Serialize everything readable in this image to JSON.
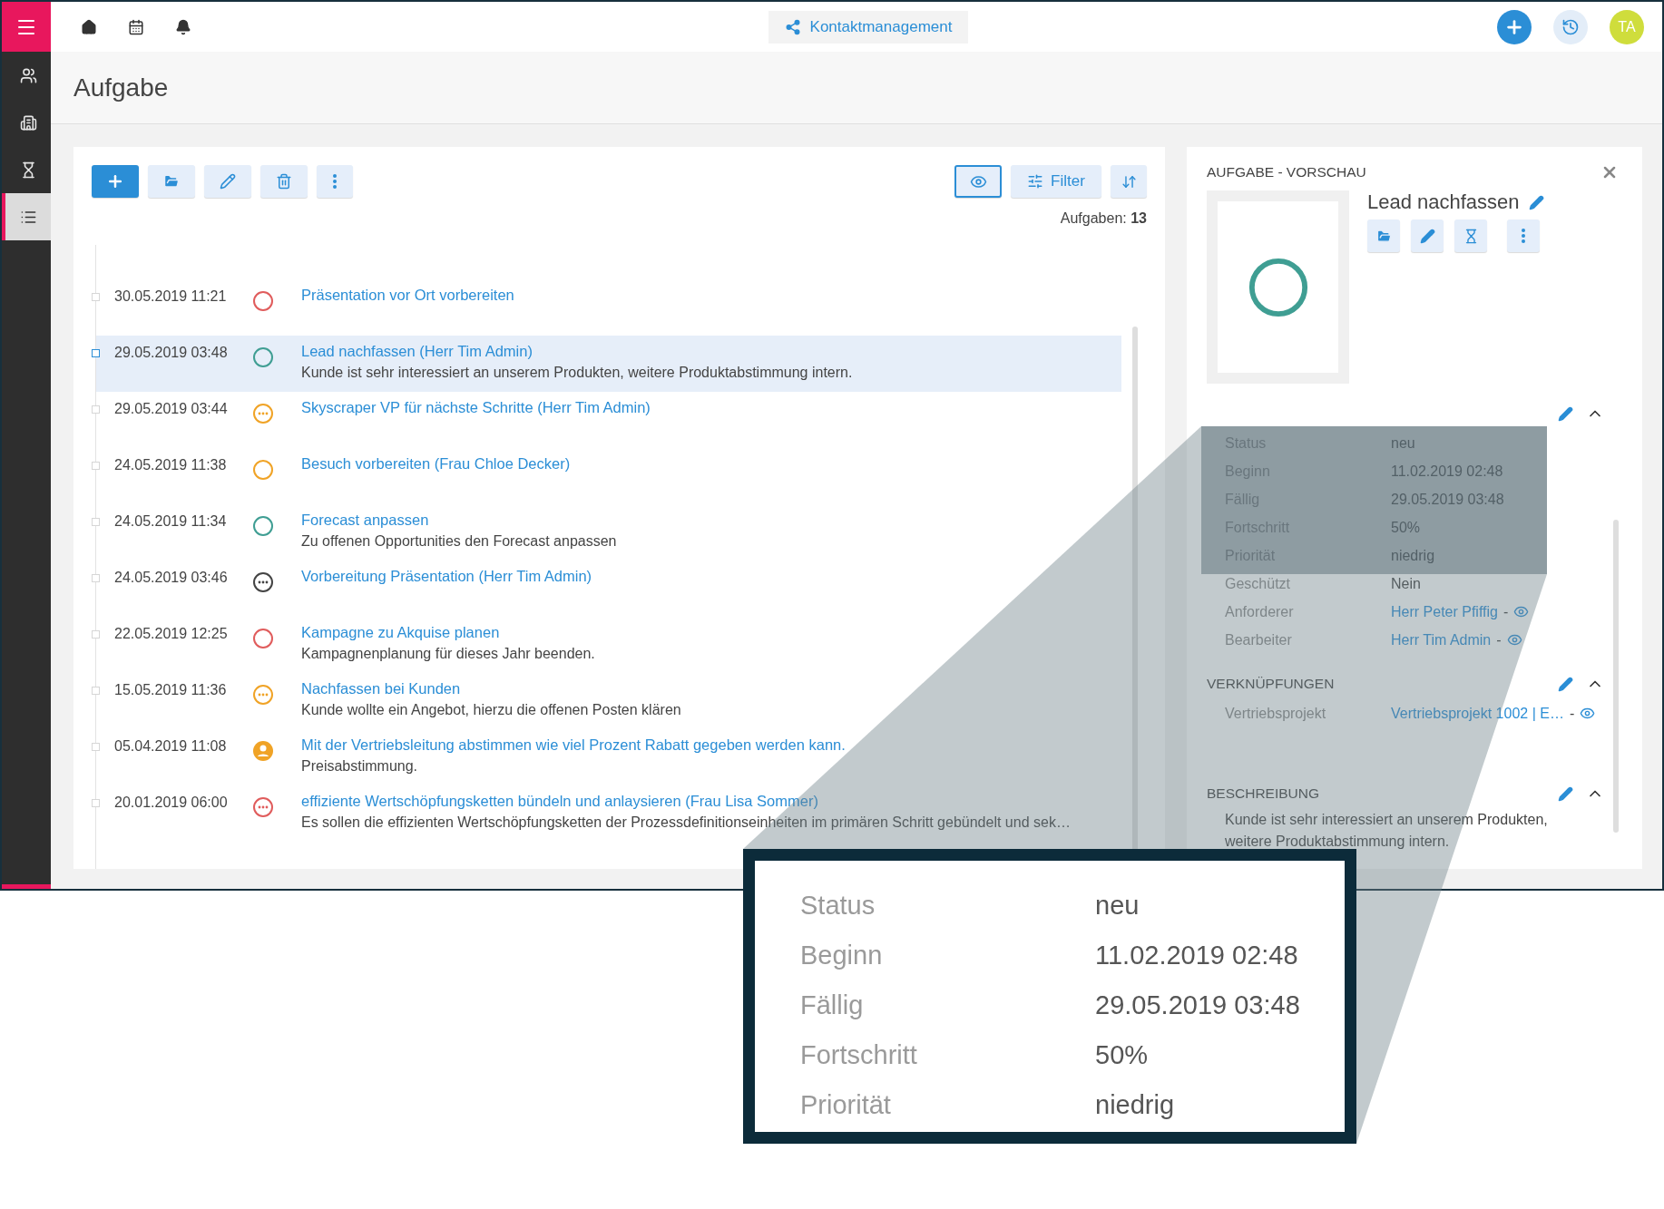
{
  "sidebar": {
    "items": [
      {
        "selected": false
      },
      {
        "selected": false
      },
      {
        "selected": false
      },
      {
        "selected": true
      }
    ]
  },
  "topbar": {
    "app_name": "Kontaktmanagement",
    "avatar": "TA"
  },
  "page": {
    "title": "Aufgabe"
  },
  "toolbar": {
    "view_toggle": {
      "selected": true
    },
    "filter_label": "Filter",
    "count": "Aufgaben: **13**"
  },
  "tasks": [
    {
      "date": "30.05.2019 11:21",
      "title": "Präsentation vor Ort vorbereiten",
      "kind": "open",
      "color": "#e05c5c",
      "selected": false
    },
    {
      "date": "29.05.2019 03:48",
      "title": "Lead nachfassen (Herr Tim Admin)",
      "description": "Kunde ist sehr interessiert an unserem Produkten, weitere Produktabstimmung intern.",
      "kind": "open",
      "color": "#3f9e93",
      "selected": true
    },
    {
      "date": "29.05.2019 03:44",
      "title": "Skyscraper VP für nächste Schritte (Herr Tim Admin)",
      "kind": "waiting",
      "color": "#f0a326",
      "selected": false
    },
    {
      "date": "24.05.2019 11:38",
      "title": "Besuch vorbereiten (Frau Chloe Decker)",
      "kind": "open",
      "color": "#f0a326",
      "selected": false
    },
    {
      "date": "24.05.2019 11:34",
      "title": "Forecast anpassen",
      "description": "Zu offenen Opportunities den Forecast anpassen",
      "kind": "open",
      "color": "#3f9e93",
      "selected": false
    },
    {
      "date": "24.05.2019 03:46",
      "title": "Vorbereitung Präsentation (Herr Tim Admin)",
      "kind": "waiting",
      "color": "#444444",
      "selected": false
    },
    {
      "date": "22.05.2019 12:25",
      "title": "Kampagne zu Akquise planen",
      "description": "Kampagnenplanung für dieses Jahr beenden.",
      "kind": "open",
      "color": "#e05c5c",
      "selected": false
    },
    {
      "date": "15.05.2019 11:36",
      "title": "Nachfassen bei Kunden",
      "description": "Kunde wollte ein Angebot, hierzu die offenen Posten klären",
      "kind": "waiting",
      "color": "#f0a326",
      "selected": false
    },
    {
      "date": "05.04.2019 11:08",
      "title": "Mit der Vertriebsleitung abstimmen wie viel Prozent Rabatt gegeben werden kann.",
      "description": "Preisabstimmung.",
      "kind": "person",
      "color": "#f0a326",
      "selected": false
    },
    {
      "date": "20.01.2019 06:00",
      "title": "effiziente Wertschöpfungsketten bündeln und anlaysieren (Frau Lisa Sommer)",
      "description": "Es sollen die effizienten Wertschöpfungsketten der Prozessdefinitionseinheiten im primären Schritt gebündelt und sek…",
      "kind": "waiting",
      "color": "#e05c5c",
      "selected": false
    }
  ],
  "preview": {
    "heading": "AUFGABE - VORSCHAU",
    "title": "Lead nachfassen",
    "status": {
      "kind": "open",
      "color": "#3f9e93"
    },
    "details": {
      "expanded": true,
      "rows": [
        {
          "label": "Status",
          "value": "neu",
          "kind": "text"
        },
        {
          "label": "Beginn",
          "value": "11.02.2019 02:48",
          "kind": "text"
        },
        {
          "label": "Fällig",
          "value": "29.05.2019 03:48",
          "kind": "text"
        },
        {
          "label": "Fortschritt",
          "value": "50%",
          "kind": "text"
        },
        {
          "label": "Priorität",
          "value": "niedrig",
          "kind": "text"
        },
        {
          "label": "Geschützt",
          "value": "Nein",
          "kind": "text"
        },
        {
          "label": "Anforderer",
          "value": "Herr Peter Pfiffig",
          "suffix": "-",
          "kind": "link"
        },
        {
          "label": "Bearbeiter",
          "value": "Herr Tim Admin",
          "suffix": "-",
          "kind": "link"
        }
      ]
    },
    "links": {
      "title": "VERKNÜPFUNGEN",
      "expanded": true,
      "rows": [
        {
          "label": "Vertriebsprojekt",
          "value": "Vertriebsprojekt 1002 | E…",
          "suffix": "-",
          "kind": "link"
        }
      ]
    },
    "description": {
      "title": "BESCHREIBUNG",
      "expanded": true,
      "text": "Kunde ist sehr interessiert an unserem Produkten, weitere Produktabstimmung intern."
    }
  },
  "callout": {
    "rows": [
      {
        "label": "Status",
        "value": "neu"
      },
      {
        "label": "Beginn",
        "value": "11.02.2019 02:48"
      },
      {
        "label": "Fällig",
        "value": "29.05.2019 03:48"
      },
      {
        "label": "Fortschritt",
        "value": "50%"
      },
      {
        "label": "Priorität",
        "value": "niedrig"
      }
    ]
  }
}
